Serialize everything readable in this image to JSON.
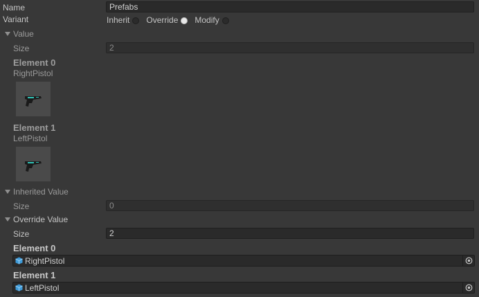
{
  "name": {
    "label": "Name",
    "value": "Prefabs"
  },
  "variant": {
    "label": "Variant",
    "options": [
      {
        "label": "Inherit",
        "selected": false
      },
      {
        "label": "Override",
        "selected": true
      },
      {
        "label": "Modify",
        "selected": false
      }
    ]
  },
  "value_section": {
    "title": "Value",
    "size_label": "Size",
    "size": "2",
    "elements": [
      {
        "title": "Element 0",
        "object": "RightPistol"
      },
      {
        "title": "Element 1",
        "object": "LeftPistol"
      }
    ]
  },
  "inherited_section": {
    "title": "Inherited Value",
    "size_label": "Size",
    "size": "0"
  },
  "override_section": {
    "title": "Override Value",
    "size_label": "Size",
    "size": "2",
    "elements": [
      {
        "title": "Element 0",
        "object": "RightPistol"
      },
      {
        "title": "Element 1",
        "object": "LeftPistol"
      }
    ]
  },
  "icons": {
    "foldout": "triangle-down-icon",
    "prefab": "prefab-cube-icon",
    "picker": "object-picker-icon",
    "preview": "pistol-preview-icon"
  },
  "colors": {
    "background": "#383838",
    "field": "#2a2a2a",
    "prefab_icon": "#3d9ad8"
  }
}
